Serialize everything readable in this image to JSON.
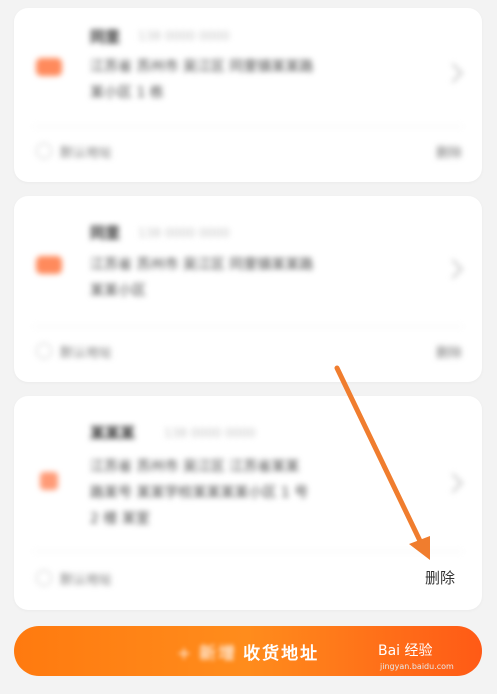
{
  "addresses": [
    {
      "name": "同里",
      "phone": "138 0000 0000",
      "address_lines": [
        "江苏省 苏州市 吴江区 同里镇某某路",
        "某小区 1 栋"
      ],
      "default_label": "默认地址",
      "delete_label": "删除"
    },
    {
      "name": "同里",
      "phone": "138 0000 0000",
      "address_lines": [
        "江苏省 苏州市 吴江区 同里镇某某路",
        "某某小区"
      ],
      "default_label": "默认地址",
      "delete_label": "删除"
    },
    {
      "name": "某某某",
      "phone": "138 0000 0000",
      "address_lines": [
        "江苏省 苏州市 吴江区 江苏省某某",
        "路某号 某某学校某某某某小区 1 号",
        "2 楼 某室"
      ],
      "default_label": "默认地址",
      "delete_label": "删除"
    }
  ],
  "add_button": {
    "icon": "plus",
    "label_blurred": "新增",
    "label": "收货地址"
  },
  "watermark": {
    "logo_text": "Bai 经验",
    "url": "jingyan.baidu.com"
  },
  "colors": {
    "accent": "#ff7a0f",
    "arrow": "#f07d2e"
  }
}
